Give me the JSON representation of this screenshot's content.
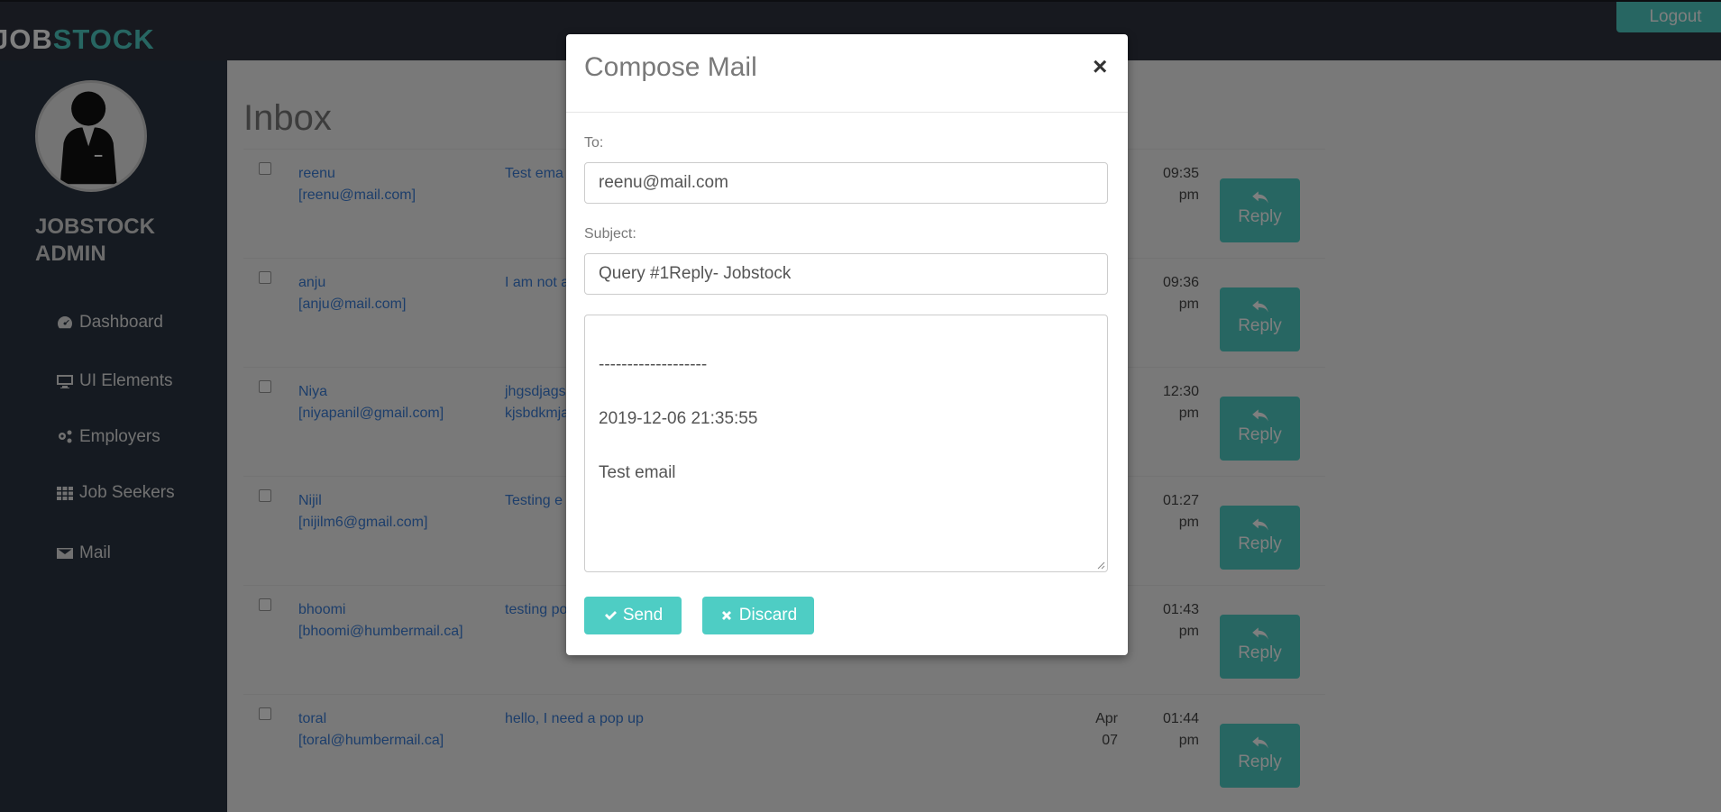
{
  "brand": {
    "part1": "JOB",
    "part2": "STOCK"
  },
  "topbar": {
    "logout_label": "Logout"
  },
  "sidebar": {
    "admin_title": "JOBSTOCK ADMIN",
    "items": [
      {
        "label": "Dashboard",
        "icon": "dashboard-icon"
      },
      {
        "label": "UI Elements",
        "icon": "desktop-icon"
      },
      {
        "label": "Employers",
        "icon": "cogs-icon"
      },
      {
        "label": "Job Seekers",
        "icon": "grid-icon"
      },
      {
        "label": "Mail",
        "icon": "envelope-icon"
      }
    ]
  },
  "inbox": {
    "title": "Inbox",
    "reply_label": "Reply",
    "rows": [
      {
        "name": "reenu",
        "email": "[reenu@mail.com]",
        "subject": "Test ema",
        "date1": "",
        "date2": "",
        "time1": "09:35",
        "time2": "pm"
      },
      {
        "name": "anju",
        "email": "[anju@mail.com]",
        "subject": "I am not a",
        "date1": "",
        "date2": "",
        "time1": "09:36",
        "time2": "pm"
      },
      {
        "name": "Niya",
        "email": "[niyapanil@gmail.com]",
        "subject": "jhgsdjags",
        "subject2": "kjsbdkmja",
        "date1": "",
        "date2": "",
        "time1": "12:30",
        "time2": "pm"
      },
      {
        "name": "Nijil",
        "email": "[nijilm6@gmail.com]",
        "subject": "Testing e",
        "date1": "",
        "date2": "",
        "time1": "01:27",
        "time2": "pm"
      },
      {
        "name": "bhoomi",
        "email": "[bhoomi@humbermail.ca]",
        "subject": "testing po",
        "date1": "",
        "date2": "",
        "time1": "01:43",
        "time2": "pm"
      },
      {
        "name": "toral",
        "email": "[toral@humbermail.ca]",
        "subject": "hello, I need a pop up",
        "date1": "Apr",
        "date2": "07",
        "time1": "01:44",
        "time2": "pm"
      }
    ]
  },
  "modal": {
    "title": "Compose Mail",
    "close": "×",
    "to_label": "To:",
    "to_value": "reenu@mail.com",
    "subject_label": "Subject:",
    "subject_value": "Query #1Reply- Jobstock",
    "body_line1": "-------------------",
    "body_line2": "2019-12-06 21:35:55",
    "body_line3": "Test email",
    "send_label": "Send",
    "discard_label": "Discard"
  },
  "colors": {
    "accent": "#4ecdc4",
    "sidebar": "#2a3542",
    "topbar": "#2f323e",
    "link": "#3a7dd6"
  }
}
